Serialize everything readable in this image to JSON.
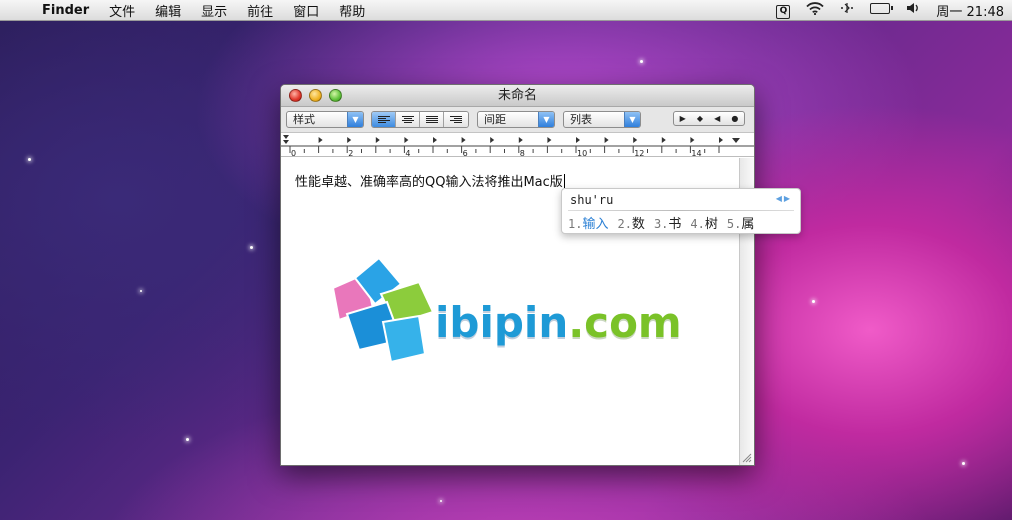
{
  "menubar": {
    "apple": "",
    "app": "Finder",
    "items": [
      "文件",
      "编辑",
      "显示",
      "前往",
      "窗口",
      "帮助"
    ],
    "status": {
      "input_icon": "Q",
      "wifi": "wifi-icon",
      "clock": "周一 21:48"
    }
  },
  "window": {
    "title": "未命名",
    "toolbar": {
      "styles": "样式",
      "spacing": "间距",
      "lists": "列表",
      "alignment": [
        "align-left",
        "align-center",
        "align-justify",
        "align-right"
      ],
      "active_alignment": "align-left"
    },
    "ruler": [
      "0",
      "2",
      "4",
      "6",
      "8",
      "10",
      "12",
      "14"
    ],
    "text": "性能卓越、准确率高的QQ输入法将推出Mac版",
    "logo": {
      "name": "ibipin",
      "domain": ".com"
    }
  },
  "ime": {
    "input": "shu'ru",
    "candidates": [
      {
        "num": "1.",
        "word": "输入",
        "selected": true
      },
      {
        "num": "2.",
        "word": "数",
        "selected": false
      },
      {
        "num": "3.",
        "word": "书",
        "selected": false
      },
      {
        "num": "4.",
        "word": "树",
        "selected": false
      },
      {
        "num": "5.",
        "word": "属",
        "selected": false
      }
    ]
  },
  "colors": {
    "accent": "#2a7fd4",
    "logo_blue": "#1e9ad6",
    "logo_green": "#7ac228"
  }
}
